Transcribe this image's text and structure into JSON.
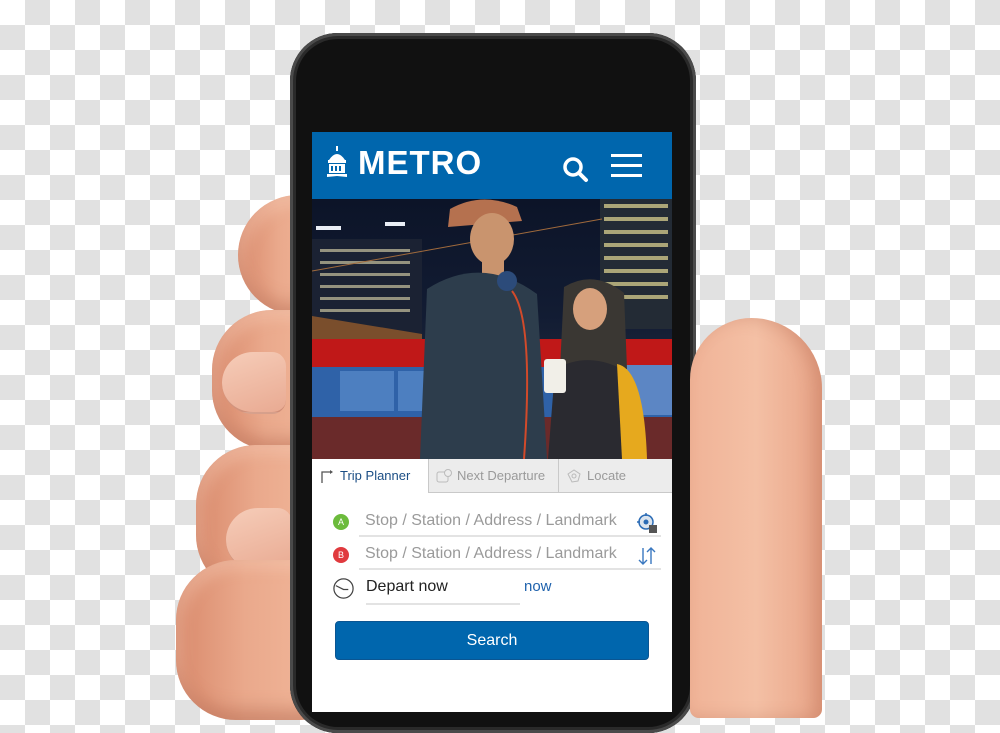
{
  "app": {
    "brand": "METRO",
    "brand_color": "#0066ad",
    "logo_icon": "capitol-dome-icon",
    "header_icons": [
      "search-icon",
      "hamburger-menu-icon"
    ]
  },
  "hero": {
    "description": "Night city photo of two people at a bus stop"
  },
  "tabs": [
    {
      "label": "Trip Planner",
      "icon": "route-arrow-icon",
      "active": true
    },
    {
      "label": "Next Departure",
      "icon": "bus-clock-icon",
      "active": false
    },
    {
      "label": "Locate",
      "icon": "map-pin-icon",
      "active": false
    }
  ],
  "trip_form": {
    "origin": {
      "badge": "A",
      "badge_color": "#6cbb3c",
      "placeholder": "Stop / Station / Address / Landmark",
      "value": "",
      "icon": "current-location-icon"
    },
    "destination": {
      "badge": "B",
      "badge_color": "#e03a3e",
      "placeholder": "Stop / Station / Address / Landmark",
      "value": "",
      "icon": "swap-arrows-icon"
    },
    "time": {
      "icon": "clock-icon",
      "value": "Depart now",
      "link": "now"
    },
    "search_label": "Search"
  }
}
